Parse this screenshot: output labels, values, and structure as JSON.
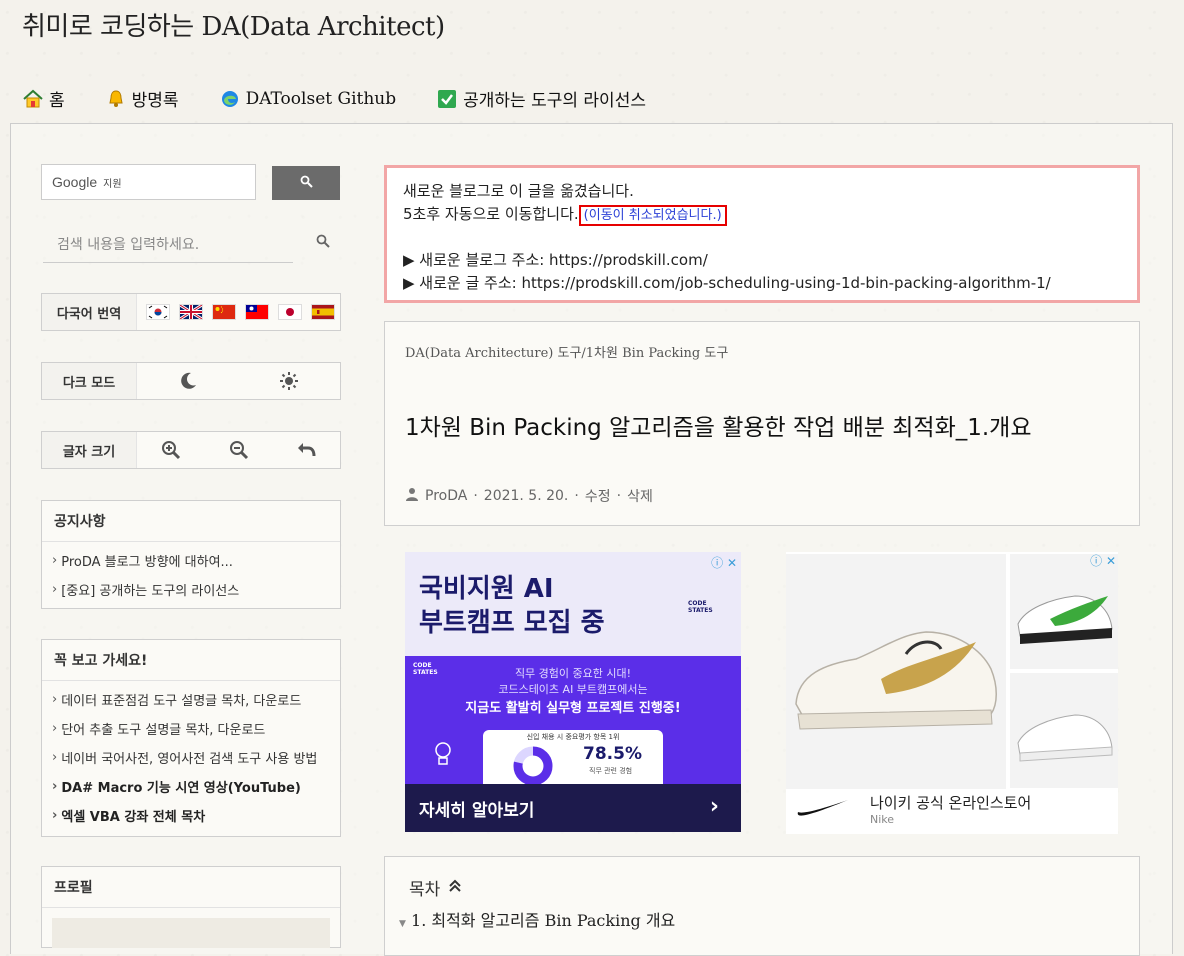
{
  "site": {
    "title": "취미로 코딩하는 DA(Data Architect)"
  },
  "nav": [
    {
      "icon": "home-icon",
      "label": "홈"
    },
    {
      "icon": "bell-icon",
      "label": "방명록"
    },
    {
      "icon": "edge-icon",
      "label": "DAToolset Github"
    },
    {
      "icon": "checkbox-icon",
      "label": "공개하는 도구의 라이선스"
    }
  ],
  "sidebar": {
    "google": {
      "brand": "Google",
      "tag": "지원"
    },
    "search": {
      "placeholder": "검색 내용을 입력하세요."
    },
    "translate_label": "다국어 번역",
    "darkmode_label": "다크 모드",
    "fontsize_label": "글자 크기",
    "notice": {
      "title": "공지사항",
      "items": [
        "ProDA 블로그 방향에 대하여...",
        "[중요] 공개하는 도구의 라이선스"
      ]
    },
    "mustsee": {
      "title": "꼭 보고 가세요!",
      "items": [
        "데이터 표준점검 도구 설명글 목차, 다운로드",
        "단어 추출 도구 설명글 목차, 다운로드",
        "네이버 국어사전, 영어사전 검색 도구 사용 방법",
        "DA# Macro 기능 시연 영상(YouTube)",
        "엑셀 VBA 강좌 전체 목차"
      ]
    },
    "profile_title": "프로필"
  },
  "notice_box": {
    "line1": "새로운 블로그로 이 글을 옮겼습니다.",
    "line2": "5초후 자동으로 이동합니다.",
    "cancel": "(이동이 취소되었습니다.)",
    "blog_addr": "▶ 새로운 블로그 주소: https://prodskill.com/",
    "post_addr": "▶ 새로운 글 주소: https://prodskill.com/job-scheduling-using-1d-bin-packing-algorithm-1/"
  },
  "post": {
    "category": "DA(Data Architecture) 도구/1차원 Bin Packing 도구",
    "title": "1차원 Bin Packing 알고리즘을 활용한 작업 배분 최적화_1.개요",
    "author": "ProDA",
    "date": "2021. 5. 20.",
    "edit": "수정",
    "delete": "삭제",
    "sep": "·"
  },
  "ad1": {
    "headline1": "국비지원 AI",
    "headline2": "부트캠프 모집 중",
    "brand": "CODE STATES",
    "body1": "직무 경험이 중요한 시대!",
    "body2": "코드스테이츠 AI 부트캠프에서는",
    "body3": "지금도 활발히 실무형 프로젝트 진행중!",
    "stat_title": "신입 채용 시 중요평가 항목 1위",
    "stat_value": "78.5%",
    "stat_sub": "직무 관련 경험",
    "cta": "자세히 알아보기"
  },
  "ad2": {
    "title": "나이키 공식 온라인스토어",
    "sub": "Nike"
  },
  "toc": {
    "title": "목차",
    "item1": "1. 최적화 알고리즘 Bin Packing 개요"
  }
}
